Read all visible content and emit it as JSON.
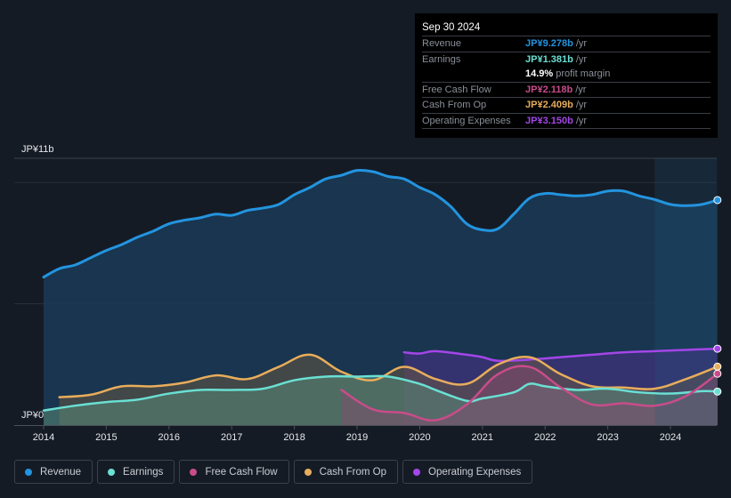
{
  "tooltip": {
    "date": "Sep 30 2024",
    "rows": [
      {
        "label": "Revenue",
        "value": "JP¥9.278b",
        "unit": "/yr",
        "color": "#2394df"
      },
      {
        "label": "Earnings",
        "value": "JP¥1.381b",
        "unit": "/yr",
        "color": "#6ae0d3"
      },
      {
        "label": "",
        "value": "14.9%",
        "unit": "profit margin",
        "color": "#ffffff"
      },
      {
        "label": "Free Cash Flow",
        "value": "JP¥2.118b",
        "unit": "/yr",
        "color": "#c94c8a"
      },
      {
        "label": "Cash From Op",
        "value": "JP¥2.409b",
        "unit": "/yr",
        "color": "#e8ad5b"
      },
      {
        "label": "Operating Expenses",
        "value": "JP¥3.150b",
        "unit": "/yr",
        "color": "#a346e8"
      }
    ]
  },
  "legend": [
    {
      "label": "Revenue",
      "color": "#2394df"
    },
    {
      "label": "Earnings",
      "color": "#6ae0d3"
    },
    {
      "label": "Free Cash Flow",
      "color": "#c94c8a"
    },
    {
      "label": "Cash From Op",
      "color": "#e8ad5b"
    },
    {
      "label": "Operating Expenses",
      "color": "#a346e8"
    }
  ],
  "chart_data": {
    "type": "area",
    "title": "",
    "xlabel": "",
    "ylabel": "",
    "y_top_label": "JP¥11b",
    "y_bottom_label": "JP¥0",
    "ylim": [
      0,
      11
    ],
    "xlim": [
      2013.5,
      2024.85
    ],
    "x_ticks": [
      "2014",
      "2015",
      "2016",
      "2017",
      "2018",
      "2019",
      "2020",
      "2021",
      "2022",
      "2023",
      "2024"
    ],
    "gridlines": [
      5,
      10,
      11
    ],
    "forecast_region_start": 2023.75,
    "legend_position": "bottom",
    "series": [
      {
        "name": "Revenue",
        "color": "#2394df",
        "x": [
          2014.0,
          2014.25,
          2014.5,
          2014.75,
          2015.0,
          2015.25,
          2015.5,
          2015.75,
          2016.0,
          2016.25,
          2016.5,
          2016.75,
          2017.0,
          2017.25,
          2017.5,
          2017.75,
          2018.0,
          2018.25,
          2018.5,
          2018.75,
          2019.0,
          2019.25,
          2019.5,
          2019.75,
          2020.0,
          2020.25,
          2020.5,
          2020.75,
          2021.0,
          2021.25,
          2021.5,
          2021.75,
          2022.0,
          2022.25,
          2022.5,
          2022.75,
          2023.0,
          2023.25,
          2023.5,
          2023.75,
          2024.0,
          2024.25,
          2024.5,
          2024.75
        ],
        "values": [
          6.1,
          6.45,
          6.6,
          6.9,
          7.2,
          7.45,
          7.75,
          8.0,
          8.3,
          8.45,
          8.55,
          8.7,
          8.65,
          8.85,
          8.95,
          9.1,
          9.5,
          9.8,
          10.15,
          10.3,
          10.5,
          10.45,
          10.25,
          10.15,
          9.8,
          9.5,
          9.0,
          8.3,
          8.05,
          8.1,
          8.7,
          9.35,
          9.55,
          9.5,
          9.45,
          9.5,
          9.65,
          9.65,
          9.45,
          9.3,
          9.1,
          9.05,
          9.1,
          9.278
        ]
      },
      {
        "name": "Earnings",
        "color": "#6ae0d3",
        "x": [
          2014.0,
          2014.5,
          2015.0,
          2015.5,
          2016.0,
          2016.5,
          2017.0,
          2017.5,
          2018.0,
          2018.5,
          2019.0,
          2019.5,
          2020.0,
          2020.25,
          2020.75,
          2021.0,
          2021.5,
          2021.75,
          2022.0,
          2022.5,
          2023.0,
          2023.5,
          2024.0,
          2024.5,
          2024.75
        ],
        "values": [
          0.6,
          0.8,
          0.95,
          1.05,
          1.3,
          1.45,
          1.45,
          1.5,
          1.85,
          2.0,
          2.0,
          2.0,
          1.7,
          1.45,
          1.0,
          1.1,
          1.35,
          1.7,
          1.6,
          1.45,
          1.5,
          1.35,
          1.3,
          1.4,
          1.381
        ]
      },
      {
        "name": "Free Cash Flow",
        "color": "#c94c8a",
        "x": [
          2018.75,
          2019.25,
          2019.75,
          2020.25,
          2020.75,
          2021.25,
          2021.75,
          2022.25,
          2022.75,
          2023.25,
          2023.75,
          2024.25,
          2024.75
        ],
        "values": [
          1.45,
          0.65,
          0.5,
          0.2,
          0.85,
          2.1,
          2.4,
          1.55,
          0.85,
          0.9,
          0.8,
          1.2,
          2.118
        ]
      },
      {
        "name": "Cash From Op",
        "color": "#e8ad5b",
        "x": [
          2014.25,
          2014.75,
          2015.25,
          2015.75,
          2016.25,
          2016.75,
          2017.25,
          2017.75,
          2018.25,
          2018.75,
          2019.25,
          2019.75,
          2020.25,
          2020.75,
          2021.25,
          2021.75,
          2022.25,
          2022.75,
          2023.25,
          2023.75,
          2024.25,
          2024.75
        ],
        "values": [
          1.15,
          1.25,
          1.6,
          1.6,
          1.75,
          2.05,
          1.9,
          2.4,
          2.9,
          2.2,
          1.85,
          2.4,
          1.9,
          1.7,
          2.5,
          2.8,
          2.1,
          1.6,
          1.55,
          1.5,
          1.9,
          2.409
        ]
      },
      {
        "name": "Operating Expenses",
        "color": "#a346e8",
        "x": [
          2019.75,
          2020.0,
          2020.25,
          2020.75,
          2021.0,
          2021.25,
          2021.75,
          2022.25,
          2022.75,
          2023.25,
          2023.75,
          2024.25,
          2024.75
        ],
        "values": [
          3.0,
          2.95,
          3.05,
          2.9,
          2.8,
          2.65,
          2.7,
          2.8,
          2.9,
          3.0,
          3.05,
          3.1,
          3.15
        ]
      }
    ]
  }
}
